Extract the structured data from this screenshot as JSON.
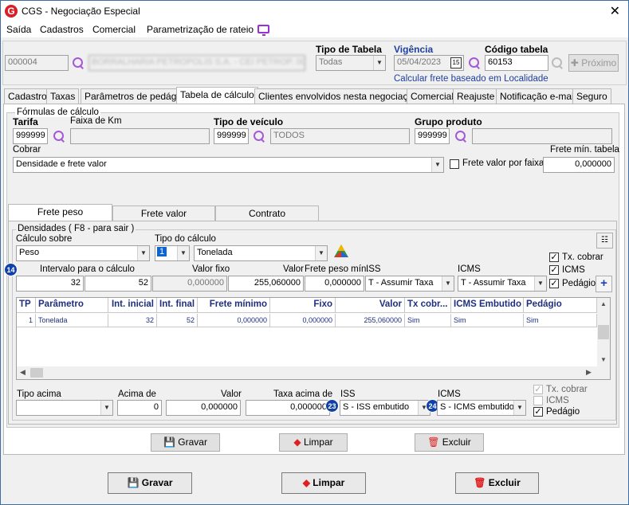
{
  "window": {
    "title": "CGS - Negociação Especial",
    "icon_letter": "G"
  },
  "menu": [
    "Saída",
    "Cadastros",
    "Comercial",
    "Parametrização de rateio"
  ],
  "header": {
    "code_value": "000004",
    "name_value": "BORRALHARIA PETROPOLIS S.A. - CEI PETROP. 000",
    "tipo_tabela_label": "Tipo de Tabela",
    "tipo_tabela_value": "Todas",
    "vigencia_label": "Vigência",
    "vigencia_value": "05/04/2023",
    "calendar_icon_text": "15",
    "codigo_tabela_label": "Código tabela",
    "codigo_tabela_value": "60153",
    "proximo_label": "Próximo",
    "calcular_link": "Calcular frete baseado em Localidade"
  },
  "tabs": [
    "Cadastro",
    "Taxas",
    "Parâmetros de pedágio",
    "Tabela de cálculo",
    "Clientes envolvidos nesta negociação",
    "Comercial",
    "Reajuste",
    "Notificação e-mail",
    "Seguro"
  ],
  "formulas": {
    "group_label": "Fórmulas de cálculo",
    "tarifa_label": "Tarifa",
    "tarifa_value": "999999",
    "faixa_label": "Faixa de Km",
    "faixa_value": "",
    "tipo_veiculo_label": "Tipo de veículo",
    "tipo_veiculo_code": "999999",
    "tipo_veiculo_value": "TODOS",
    "grupo_produto_label": "Grupo produto",
    "grupo_produto_code": "999999",
    "grupo_produto_value": "",
    "cobrar_label": "Cobrar",
    "cobrar_value": "Densidade e frete valor",
    "frete_faixas_label": "Frete valor por faixas",
    "frete_min_label": "Frete mín. tabela",
    "frete_min_value": "0,000000"
  },
  "inner_tabs": [
    "Frete peso",
    "Frete valor",
    "Contrato"
  ],
  "densidades": {
    "group_label": "Densidades ( F8 - para sair )",
    "calculo_sobre_label": "Cálculo sobre",
    "calculo_sobre_value": "Peso",
    "tipo_calculo_label": "Tipo do cálculo",
    "tipo_calculo_code": "1",
    "tipo_calculo_value": "Tonelada",
    "intervalo_label": "Intervalo para o cálculo",
    "intervalo_from": "32",
    "intervalo_to": "52",
    "valor_fixo_label": "Valor fixo",
    "valor_fixo_value": "0,000000",
    "valor_label": "Valor",
    "valor_value": "255,060000",
    "frete_peso_min_label": "Frete peso mín.",
    "frete_peso_min_value": "0,000000",
    "iss_label": "ISS",
    "iss_value": "T - Assumir Taxa",
    "icms_label": "ICMS",
    "icms_value": "T - Assumir Taxa",
    "tx_cobrar_label": "Tx. cobrar",
    "icms_chk_label": "ICMS",
    "pedagio_label": "Pedágio",
    "badge_14": "14"
  },
  "grid": {
    "headers": [
      "TP",
      "Parâmetro",
      "Int. inicial",
      "Int. final",
      "Frete mínimo",
      "Fixo",
      "Valor",
      "Tx cobr...",
      "ICMS Embutido",
      "Pedágio"
    ],
    "rows": [
      [
        "1",
        "Tonelada",
        "32",
        "52",
        "0,000000",
        "0,000000",
        "255,060000",
        "Sim",
        "Sim",
        "Sim"
      ]
    ]
  },
  "acima": {
    "tipo_acima_label": "Tipo acima",
    "tipo_acima_value": "",
    "acima_de_label": "Acima de",
    "acima_de_value": "0",
    "valor_label": "Valor",
    "valor_value": "0,000000",
    "taxa_acima_label": "Taxa acima de",
    "taxa_acima_value": "0,000000",
    "iss_label": "ISS",
    "iss_value": "S - ISS embutido",
    "icms_label": "ICMS",
    "icms_value": "S - ICMS embutido",
    "tx_cobrar_label": "Tx. cobrar",
    "icms_chk_label": "ICMS",
    "pedagio_label": "Pedágio",
    "badge_23": "23",
    "badge_24": "24"
  },
  "inner_buttons": {
    "gravar": "Gravar",
    "limpar": "Limpar",
    "excluir": "Excluir"
  },
  "footer_buttons": {
    "gravar": "Gravar",
    "limpar": "Limpar",
    "excluir": "Excluir"
  },
  "colors": {
    "accent_purple": "#a45ad6",
    "badge_blue": "#1040a8",
    "grid_text": "#1f2f7f",
    "app_red": "#d61f26"
  }
}
